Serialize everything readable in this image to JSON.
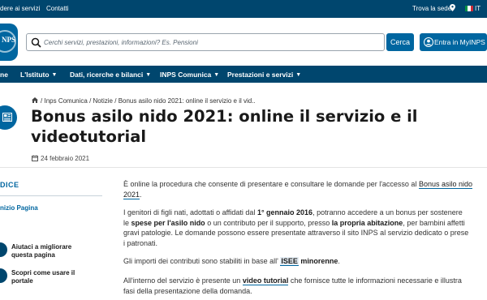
{
  "topbar": {
    "link1": "dere ai servizi",
    "link2": "Contatti",
    "trova_sede": "Trova la sede",
    "language": "IT",
    "flag_colors": [
      "#009246",
      "#ffffff",
      "#ce2b37"
    ]
  },
  "header": {
    "logo_text": "NPS",
    "search_placeholder": "Cerchi servizi, prestazioni, informazioni? Es. Pensioni",
    "search_button": "Cerca",
    "login_button": "Entra in MyINPS"
  },
  "nav": {
    "items": [
      {
        "label": "ne"
      },
      {
        "label": "L'Istituto"
      },
      {
        "label": "Dati, ricerche e bilanci"
      },
      {
        "label": "INPS Comunica"
      },
      {
        "label": "Prestazioni e servizi"
      }
    ]
  },
  "breadcrumb": {
    "items": [
      "Inps Comunica",
      "Notizie",
      "Bonus asilo nido 2021: online il servizio e il vid.."
    ],
    "separator": "/"
  },
  "page": {
    "title": "Bonus asilo nido 2021: online il servizio e il videotutorial",
    "date": "24 febbraio 2021"
  },
  "sidebar": {
    "heading": "DICE",
    "start_link": "nizio Pagina",
    "links": [
      {
        "line1": "Aiutaci a migliorare",
        "line2": "questa pagina"
      },
      {
        "line1": "Scopri come usare il",
        "line2": "portale"
      }
    ]
  },
  "article": {
    "p1": {
      "a": "È online la procedura che consente di presentare e consultare le domande per l'accesso al ",
      "link": "Bonus asilo nido",
      "link2": "2021",
      "b": "."
    },
    "p2": {
      "a": "I genitori di figli nati, adottati o affidati dal ",
      "b1": "1° gennaio 2016",
      "c": ", potranno accedere a un bonus per sostenere",
      "d": "le ",
      "b2": "spese per l'asilo nido",
      "e": " o un contributo per il supporto, presso ",
      "b3": "la propria abitazione",
      "f": ", per bambini affetti",
      "g": "gravi patologie. Le domande possono essere presentate attraverso il sito INPS al servizio dedicato o prese",
      "h": "i patronati."
    },
    "p3": {
      "a": "Gli importi dei contributi sono stabiliti in base all' ",
      "isee": "ISEE",
      "b": " minorenne",
      "c": "."
    },
    "p4": {
      "a": "All'interno del servizio è presente un ",
      "link": "video tutorial",
      "b": " che fornisce tutte le informazioni necessarie e illustra",
      "c": "fasi della presentazione della domanda."
    }
  },
  "colors": {
    "dark_blue": "#00466e",
    "primary_blue": "#0066a0"
  }
}
